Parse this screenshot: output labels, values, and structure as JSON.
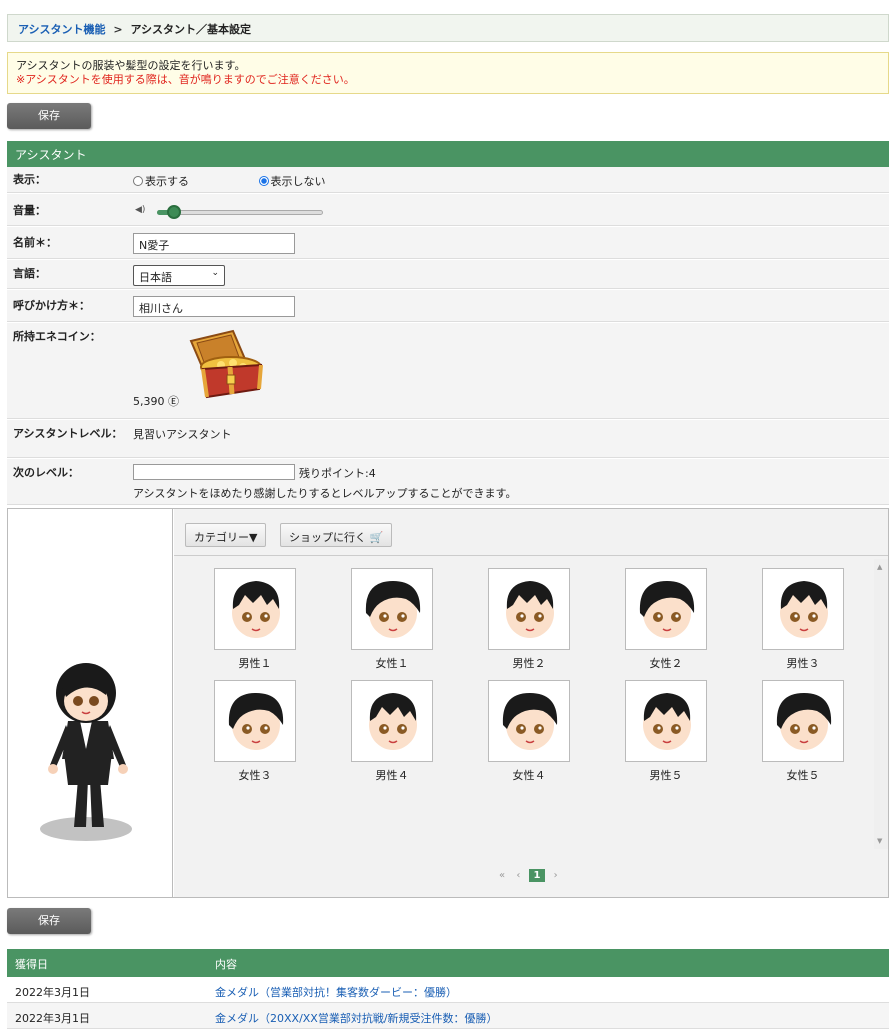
{
  "breadcrumb": {
    "parent": "アシスタント機能",
    "separator": ">",
    "current": "アシスタント／基本設定"
  },
  "notice": {
    "line1": "アシスタントの服装や髪型の設定を行います。",
    "line2": "※アシスタントを使用する際は、音が鳴りますのでご注意ください。"
  },
  "buttons": {
    "save": "保存"
  },
  "section": {
    "title": "アシスタント"
  },
  "form": {
    "display_label": "表示：",
    "display_show": "表示する",
    "display_hide": "表示しない",
    "display_selected": "表示しない",
    "volume_label": "音量：",
    "volume_level": 0.15,
    "name_label": "名前＊：",
    "name_value": "N愛子",
    "language_label": "言語：",
    "language_value": "日本語",
    "call_label": "呼びかけ方＊：",
    "call_value": "相川さん",
    "coins_label": "所持エネコイン：",
    "coins_value": "5,390",
    "coin_symbol": "Ⓔ",
    "level_label": "アシスタントレベル：",
    "level_value": "見習いアシスタント",
    "next_label": "次のレベル：",
    "next_value": "",
    "remaining_label": "残りポイント:4",
    "level_hint": "アシスタントをほめたり感謝したりするとレベルアップすることができます。"
  },
  "wardrobe": {
    "category_button": "カテゴリー▼",
    "shop_button": "ショップに行く",
    "items": [
      {
        "label": "男性１",
        "hair": "male"
      },
      {
        "label": "女性１",
        "hair": "female"
      },
      {
        "label": "男性２",
        "hair": "male"
      },
      {
        "label": "女性２",
        "hair": "female"
      },
      {
        "label": "男性３",
        "hair": "male"
      },
      {
        "label": "女性３",
        "hair": "female"
      },
      {
        "label": "男性４",
        "hair": "male"
      },
      {
        "label": "女性４",
        "hair": "female"
      },
      {
        "label": "男性５",
        "hair": "male"
      },
      {
        "label": "女性５",
        "hair": "female"
      }
    ],
    "pager": {
      "first": "«",
      "prev": "‹",
      "current": "1",
      "next": "›"
    }
  },
  "history": {
    "col_date": "獲得日",
    "col_content": "内容",
    "rows": [
      {
        "date": "2022年3月1日",
        "content": "金メダル（営業部対抗！集客数ダービー：優勝）"
      },
      {
        "date": "2022年3月1日",
        "content": "金メダル（20XX/XX営業部対抗戦/新規受注件数：優勝）"
      }
    ]
  },
  "colors": {
    "accent": "#4a9463",
    "link": "#1a5fb4",
    "warning": "#e0251e"
  }
}
